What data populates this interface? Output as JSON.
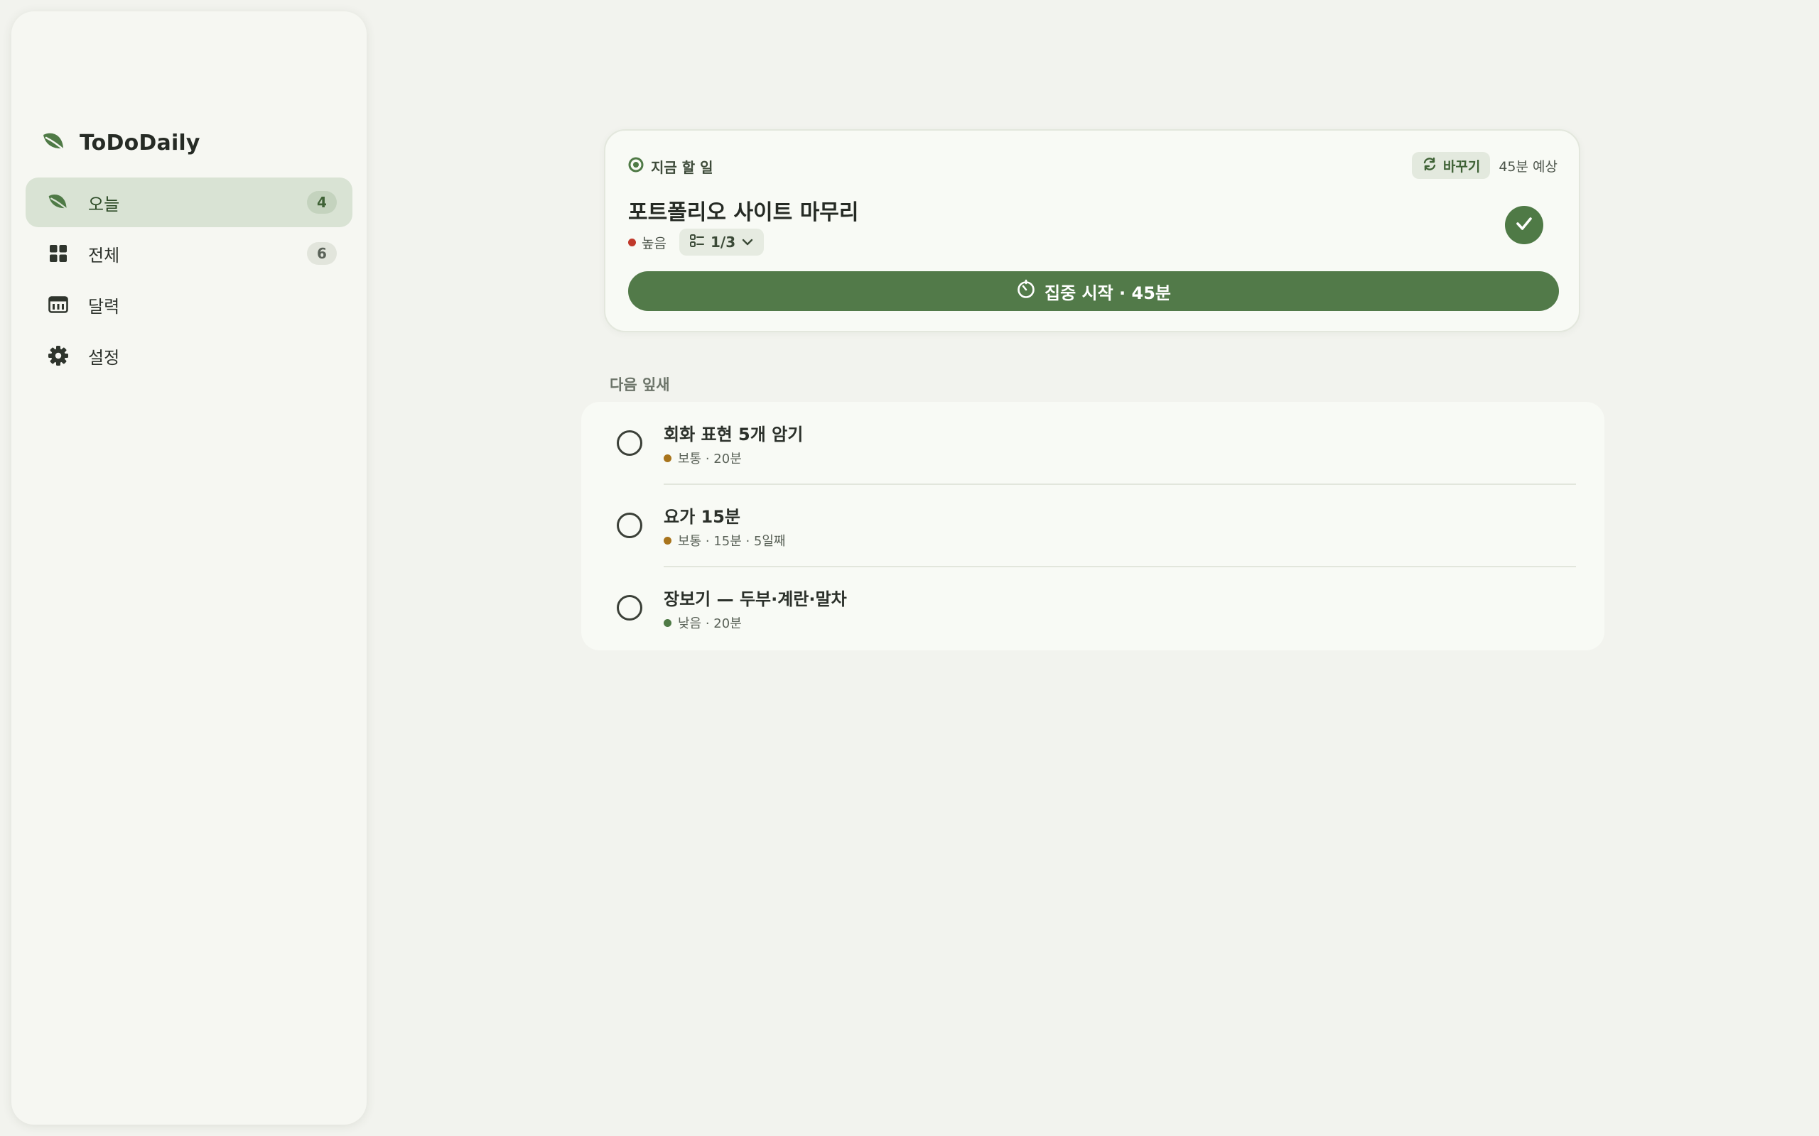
{
  "app": {
    "name": "ToDoDaily"
  },
  "sidebar": {
    "items": [
      {
        "label": "오늘",
        "count": "4",
        "icon": "leaf-icon",
        "active": true
      },
      {
        "label": "전체",
        "count": "6",
        "icon": "grid-icon"
      },
      {
        "label": "달력",
        "icon": "calendar-icon"
      },
      {
        "label": "설정",
        "icon": "gear-icon"
      }
    ]
  },
  "focus": {
    "section_label": "지금 할 일",
    "swap_label": "바꾸기",
    "estimate": "45분 예상",
    "title": "포트폴리오 사이트 마무리",
    "priority": "높음",
    "subtasks": "1/3",
    "start_label": "집중 시작 · 45분"
  },
  "next": {
    "label": "다음 잎새",
    "items": [
      {
        "title": "회화 표현 5개 암기",
        "meta": "보통 · 20분",
        "priority_color": "#a8741c"
      },
      {
        "title": "요가 15분",
        "meta": "보통 · 15분 · 5일째",
        "priority_color": "#a8741c"
      },
      {
        "title": "장보기 — 두부·계란·말차",
        "meta": "낮음 · 20분",
        "priority_color": "#4f7a46"
      }
    ]
  },
  "colors": {
    "accent": "#527a49",
    "priority_high": "#c0392b",
    "priority_medium": "#a8741c",
    "priority_low": "#4f7a46"
  }
}
